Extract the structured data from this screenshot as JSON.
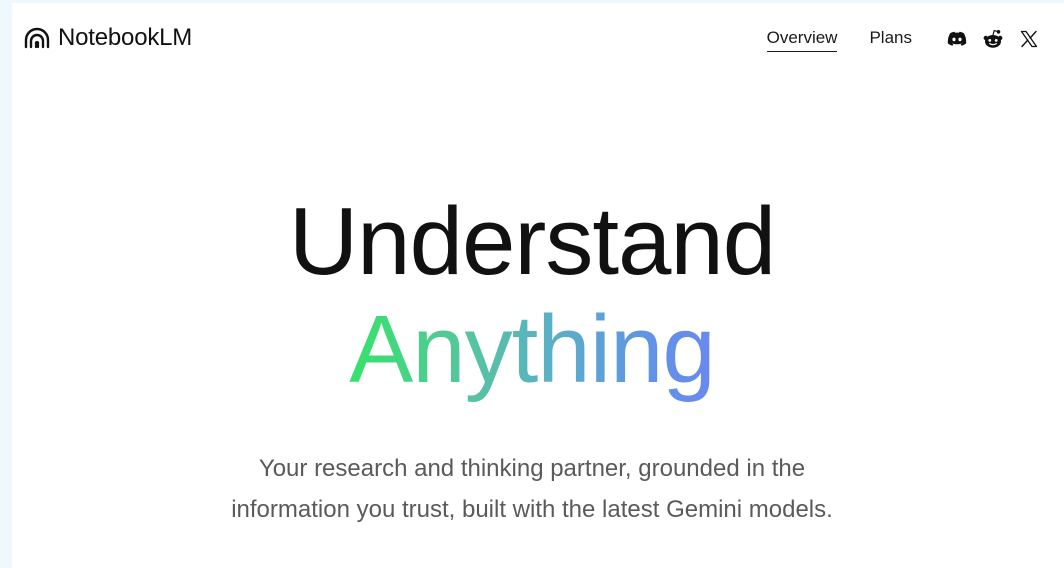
{
  "header": {
    "brand_name": "NotebookLM",
    "brand_icon": "notebooklm-logo-icon",
    "nav": [
      {
        "label": "Overview",
        "active": true
      },
      {
        "label": "Plans",
        "active": false
      }
    ],
    "social_icons": [
      "discord-icon",
      "reddit-icon",
      "x-icon"
    ]
  },
  "hero": {
    "line1": "Understand",
    "line2": "Anything",
    "line2_gradient": [
      "#34e36a",
      "#55c79a",
      "#5ab0c6",
      "#5f95e4",
      "#6a88f0"
    ]
  },
  "subtitle": {
    "line1": "Your research and thinking partner, grounded in the",
    "line2": "information you trust, built with the latest Gemini models."
  },
  "colors": {
    "text": "#111111",
    "subtitle": "#5a5a5a",
    "background": "#ffffff",
    "edge": "#eef8fd"
  }
}
